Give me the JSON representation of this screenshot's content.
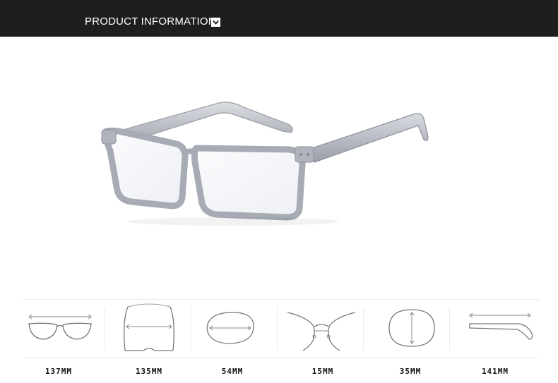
{
  "header": {
    "title": "PRODUCT INFORMATION",
    "chevron_icon": "chevron-down-icon"
  },
  "hero": {
    "image_subject": "eyeglasses-icon",
    "frame_color": "#b9bcc4"
  },
  "dimensions": [
    {
      "icon": "frame-width-icon",
      "label": "137MM"
    },
    {
      "icon": "temple-spread-icon",
      "label": "135MM"
    },
    {
      "icon": "lens-width-icon",
      "label": "54MM"
    },
    {
      "icon": "bridge-width-icon",
      "label": "15MM"
    },
    {
      "icon": "lens-height-icon",
      "label": "35MM"
    },
    {
      "icon": "temple-length-icon",
      "label": "141MM"
    }
  ]
}
